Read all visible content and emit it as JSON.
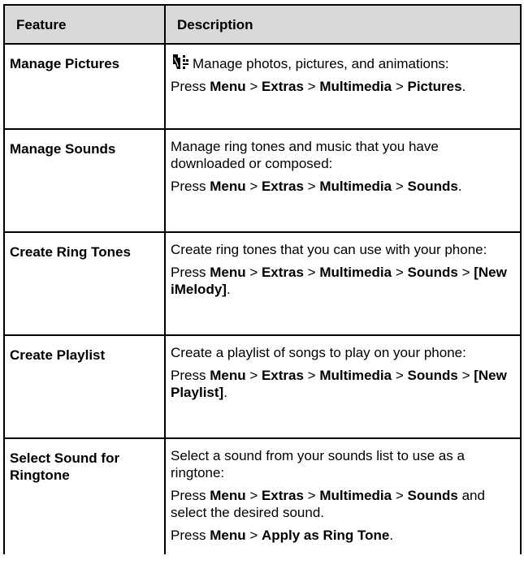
{
  "table": {
    "header": {
      "feature": "Feature",
      "description": "Description"
    },
    "rows": [
      {
        "feature": "Manage Pictures",
        "intro": "Manage photos, pictures, and animations:",
        "icon": "multimedia-icon",
        "press": "Press",
        "menu": "Menu",
        "extras": "Extras",
        "multimedia": "Multimedia",
        "target": "Pictures",
        "end": "."
      },
      {
        "feature": "Manage Sounds",
        "intro": "Manage ring tones and music that you have downloaded or composed:",
        "press": "Press",
        "menu": "Menu",
        "extras": "Extras",
        "multimedia": "Multimedia",
        "target": "Sounds",
        "end": "."
      },
      {
        "feature": "Create Ring Tones",
        "intro": "Create ring tones that you can use with your phone:",
        "press": "Press",
        "menu": "Menu",
        "extras": "Extras",
        "multimedia": "Multimedia",
        "target": "Sounds",
        "option": "[New iMelody]",
        "end": "."
      },
      {
        "feature": "Create Playlist",
        "intro": "Create a playlist of songs to play on your phone:",
        "press": "Press",
        "menu": "Menu",
        "extras": "Extras",
        "multimedia": "Multimedia",
        "target": "Sounds",
        "option": "[New Playlist]",
        "end": "."
      },
      {
        "feature": "Select Sound for Ringtone",
        "intro": "Select a sound from your sounds list to use as a ringtone:",
        "press": "Press",
        "menu": "Menu",
        "extras": "Extras",
        "multimedia": "Multimedia",
        "target": "Sounds",
        "tail": "and select the desired sound.",
        "press2": "Press",
        "menu2": "Menu",
        "apply": "Apply as Ring Tone",
        "end": "."
      }
    ]
  }
}
